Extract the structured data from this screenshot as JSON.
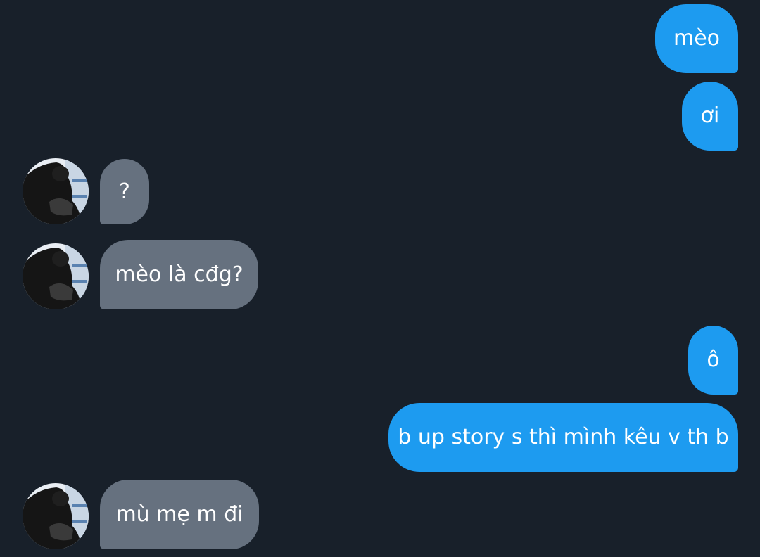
{
  "theme": {
    "background": "#18202a",
    "outgoing_bubble": "#1d9bf0",
    "incoming_bubble": "#66717f",
    "text": "#ffffff"
  },
  "messages": [
    {
      "sender": "me",
      "text": "mèo"
    },
    {
      "sender": "me",
      "text": "ơi"
    },
    {
      "sender": "other",
      "text": "?",
      "avatar": "user-avatar-photo"
    },
    {
      "sender": "other",
      "text": "mèo là cđg?",
      "avatar": "user-avatar-photo"
    },
    {
      "sender": "me",
      "text": "ô"
    },
    {
      "sender": "me",
      "text": "b up story s thì mình kêu v th b"
    },
    {
      "sender": "other",
      "text": "mù mẹ m đi",
      "avatar": "user-avatar-photo"
    }
  ]
}
